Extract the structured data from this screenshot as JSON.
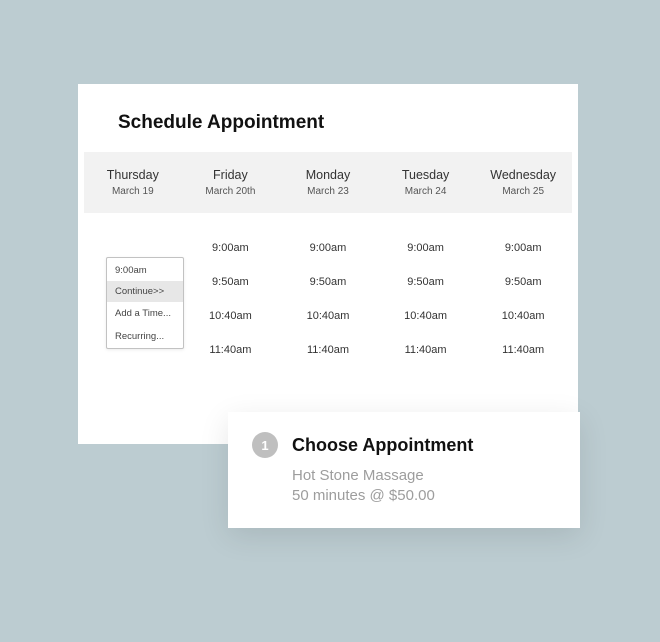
{
  "schedule": {
    "title": "Schedule Appointment",
    "days": [
      {
        "name": "Thursday",
        "date": "March 19"
      },
      {
        "name": "Friday",
        "date": "March 20th"
      },
      {
        "name": "Monday",
        "date": "March 23"
      },
      {
        "name": "Tuesday",
        "date": "March 24"
      },
      {
        "name": "Wednesday",
        "date": "March 25"
      }
    ],
    "times": [
      "9:00am",
      "9:50am",
      "10:40am",
      "11:40am"
    ]
  },
  "popover": {
    "selected_time": "9:00am",
    "continue_label": "Continue>>",
    "add_time_label": "Add a Time...",
    "recurring_label": "Recurring..."
  },
  "appointment": {
    "step": "1",
    "title": "Choose Appointment",
    "service": "Hot Stone Massage",
    "details": "50 minutes @ $50.00"
  }
}
